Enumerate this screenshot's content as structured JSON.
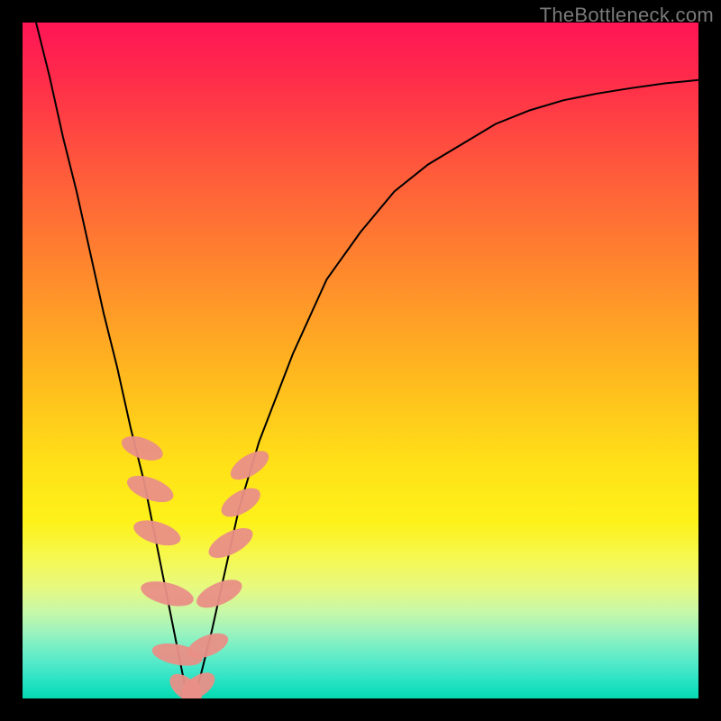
{
  "watermark": "TheBottleneck.com",
  "chart_data": {
    "type": "line",
    "title": "",
    "xlabel": "",
    "ylabel": "",
    "xlim": [
      0,
      100
    ],
    "ylim": [
      0,
      100
    ],
    "grid": false,
    "legend": false,
    "series": [
      {
        "name": "curve",
        "x": [
          2,
          4,
          6,
          8,
          10,
          12,
          14,
          16,
          18,
          20,
          21,
          22,
          23,
          24,
          25,
          26,
          28,
          30,
          32,
          35,
          40,
          45,
          50,
          55,
          60,
          65,
          70,
          75,
          80,
          85,
          90,
          95,
          100
        ],
        "values": [
          100,
          92,
          83,
          75,
          66,
          57,
          49,
          40,
          32,
          22,
          17,
          12,
          7,
          2,
          0,
          2,
          10,
          19,
          28,
          38,
          51,
          62,
          69,
          75,
          79,
          82,
          85,
          87,
          88.5,
          89.5,
          90.3,
          91,
          91.5
        ]
      }
    ],
    "markers": [
      {
        "x": 17.7,
        "y": 37,
        "rx": 1.5,
        "ry": 3.2,
        "angle": -70
      },
      {
        "x": 18.9,
        "y": 31,
        "rx": 1.6,
        "ry": 3.6,
        "angle": -70
      },
      {
        "x": 19.9,
        "y": 24.5,
        "rx": 1.6,
        "ry": 3.6,
        "angle": -73
      },
      {
        "x": 21.4,
        "y": 15.5,
        "rx": 1.6,
        "ry": 4.0,
        "angle": -76
      },
      {
        "x": 22.9,
        "y": 6.5,
        "rx": 1.5,
        "ry": 3.8,
        "angle": -79
      },
      {
        "x": 24.0,
        "y": 1.6,
        "rx": 1.5,
        "ry": 2.6,
        "angle": -50
      },
      {
        "x": 25.0,
        "y": 0.3,
        "rx": 1.5,
        "ry": 2.6,
        "angle": 0
      },
      {
        "x": 26.0,
        "y": 1.8,
        "rx": 1.5,
        "ry": 2.8,
        "angle": 55
      },
      {
        "x": 27.4,
        "y": 7.8,
        "rx": 1.5,
        "ry": 3.2,
        "angle": 68
      },
      {
        "x": 29.1,
        "y": 15.5,
        "rx": 1.6,
        "ry": 3.6,
        "angle": 66
      },
      {
        "x": 30.8,
        "y": 23,
        "rx": 1.6,
        "ry": 3.6,
        "angle": 62
      },
      {
        "x": 32.3,
        "y": 29,
        "rx": 1.6,
        "ry": 3.2,
        "angle": 60
      },
      {
        "x": 33.6,
        "y": 34.5,
        "rx": 1.5,
        "ry": 3.2,
        "angle": 58
      }
    ],
    "gradient_colors": {
      "top": "#ff1555",
      "mid": "#ffe018",
      "bottom": "#06d9b0"
    }
  }
}
